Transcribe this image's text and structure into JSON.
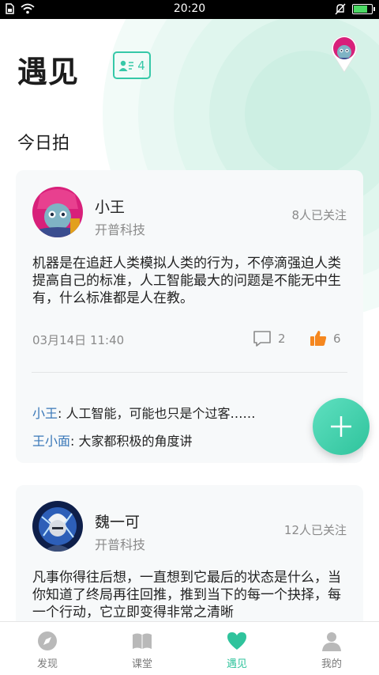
{
  "status_bar": {
    "time": "20:20"
  },
  "header": {
    "title": "遇见",
    "follow_count": "4"
  },
  "section": {
    "title": "今日拍"
  },
  "posts": [
    {
      "user_name": "小王",
      "company": "开普科技",
      "followers": "8人已关注",
      "text": "机器是在追赶人类模拟人类的行为，不停滴强迫人类提高自己的标准，人工智能最大的问题是不能无中生有，什么标准都是人在教。",
      "time": "03月14日 11:40",
      "comments_count": "2",
      "likes_count": "6",
      "comments": [
        {
          "name": "小王",
          "text": ": 人工智能，可能也只是个过客……"
        },
        {
          "name": "王小面",
          "text": ": 大家都积极的角度讲"
        }
      ]
    },
    {
      "user_name": "魏一可",
      "company": "开普科技",
      "followers": "12人已关注",
      "text": "凡事你得往后想，一直想到它最后的状态是什么，当你知道了终局再往回推，推到当下的每一个抉择，每一个行动，它立即变得非常之清晰"
    }
  ],
  "bottom_nav": [
    {
      "label": "发现",
      "icon": "compass-icon"
    },
    {
      "label": "课堂",
      "icon": "book-icon"
    },
    {
      "label": "遇见",
      "icon": "heart-icon"
    },
    {
      "label": "我的",
      "icon": "person-icon"
    }
  ],
  "colors": {
    "accent": "#2fc39c",
    "like": "#f5871f",
    "comment_name": "#3a78b8"
  }
}
